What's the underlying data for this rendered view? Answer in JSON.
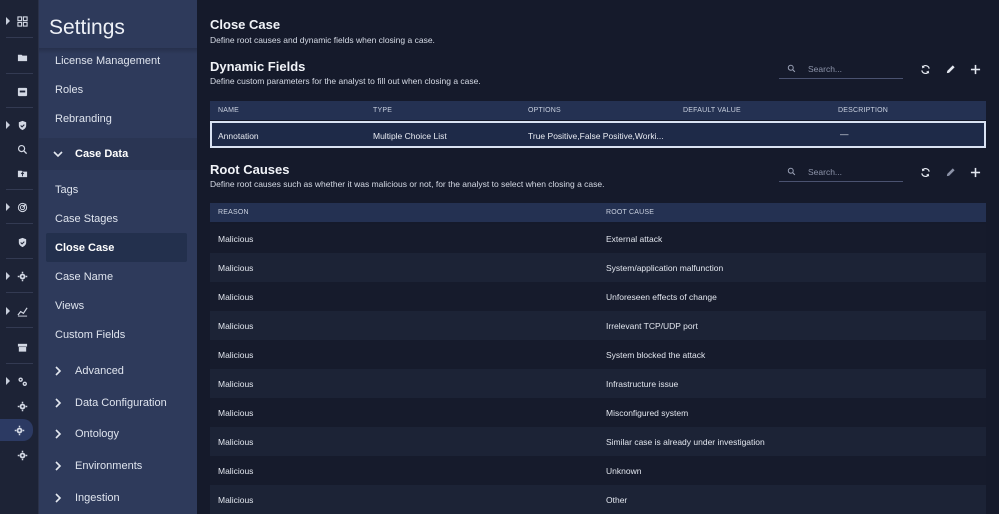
{
  "rail": {
    "icons": [
      "grid-icon",
      "folder-icon",
      "inbox-icon",
      "shield-check-icon",
      "search-icon",
      "folder-upload-icon",
      "radar-icon",
      "shield-icon",
      "gear-icon",
      "chart-icon",
      "archive-icon",
      "gears-icon",
      "gear-icon",
      "settings-icon",
      "gear-icon"
    ]
  },
  "nav": {
    "title": "Settings",
    "items_top": [
      "License Management",
      "Roles",
      "Rebranding"
    ],
    "case_data": {
      "label": "Case Data",
      "children": [
        "Tags",
        "Case Stages",
        "Close Case",
        "Case Name",
        "Views",
        "Custom Fields"
      ],
      "active": "Close Case"
    },
    "groups": [
      "Advanced",
      "Data Configuration",
      "Ontology",
      "Environments",
      "Ingestion"
    ]
  },
  "page": {
    "title": "Close Case",
    "subtitle": "Define root causes and dynamic fields when closing a case."
  },
  "dynamic_fields": {
    "title": "Dynamic Fields",
    "subtitle": "Define custom parameters for the analyst to fill out when closing a case.",
    "search_placeholder": "Search...",
    "columns": [
      "NAME",
      "TYPE",
      "OPTIONS",
      "DEFAULT VALUE",
      "DESCRIPTION"
    ],
    "rows": [
      {
        "name": "Annotation",
        "type": "Multiple Choice List",
        "options": "True Positive,False Positive,Worki...",
        "default_value": "",
        "description": "—"
      }
    ]
  },
  "root_causes": {
    "title": "Root Causes",
    "subtitle": "Define root causes such as whether it was malicious or not, for the analyst to select when closing a case.",
    "search_placeholder": "Search...",
    "columns": [
      "REASON",
      "ROOT CAUSE"
    ],
    "rows": [
      {
        "reason": "Malicious",
        "root_cause": "External attack"
      },
      {
        "reason": "Malicious",
        "root_cause": "System/application malfunction"
      },
      {
        "reason": "Malicious",
        "root_cause": "Unforeseen effects of change"
      },
      {
        "reason": "Malicious",
        "root_cause": "Irrelevant TCP/UDP port"
      },
      {
        "reason": "Malicious",
        "root_cause": "System blocked the attack"
      },
      {
        "reason": "Malicious",
        "root_cause": "Infrastructure issue"
      },
      {
        "reason": "Malicious",
        "root_cause": "Misconfigured system"
      },
      {
        "reason": "Malicious",
        "root_cause": "Similar case is already under investigation"
      },
      {
        "reason": "Malicious",
        "root_cause": "Unknown"
      },
      {
        "reason": "Malicious",
        "root_cause": "Other"
      }
    ]
  },
  "colors": {
    "accent": "#2c3a63",
    "nav_bg": "#2e3a5b",
    "main_bg": "#151a2b",
    "selected_border": "#d9e2f2"
  }
}
